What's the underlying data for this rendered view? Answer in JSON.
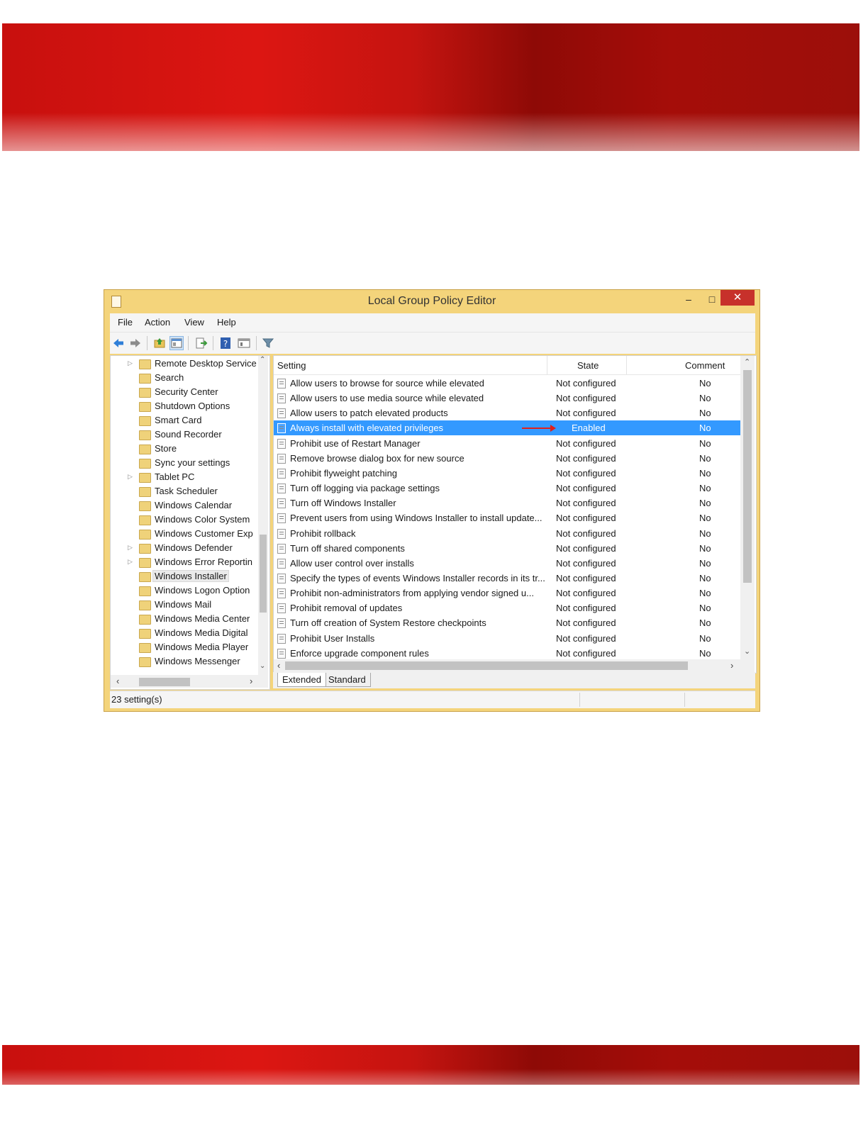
{
  "window": {
    "title": "Local Group Policy Editor",
    "minimize_glyph": "‒",
    "maximize_glyph": "□",
    "close_glyph": "✕"
  },
  "menubar": [
    "File",
    "Action",
    "View",
    "Help"
  ],
  "toolbar_icons": [
    "back-arrow-icon",
    "forward-arrow-icon",
    "up-folder-icon",
    "show-hide-tree-icon",
    "export-list-icon",
    "help-icon",
    "properties-view-icon",
    "filter-icon"
  ],
  "tree": {
    "items": [
      {
        "label": "Remote Desktop Service",
        "expandable": true
      },
      {
        "label": "Search",
        "expandable": false
      },
      {
        "label": "Security Center",
        "expandable": false
      },
      {
        "label": "Shutdown Options",
        "expandable": false
      },
      {
        "label": "Smart Card",
        "expandable": false
      },
      {
        "label": "Sound Recorder",
        "expandable": false
      },
      {
        "label": "Store",
        "expandable": false
      },
      {
        "label": "Sync your settings",
        "expandable": false
      },
      {
        "label": "Tablet PC",
        "expandable": true
      },
      {
        "label": "Task Scheduler",
        "expandable": false
      },
      {
        "label": "Windows Calendar",
        "expandable": false
      },
      {
        "label": "Windows Color System",
        "expandable": false
      },
      {
        "label": "Windows Customer Exp",
        "expandable": false
      },
      {
        "label": "Windows Defender",
        "expandable": true
      },
      {
        "label": "Windows Error Reportin",
        "expandable": true
      },
      {
        "label": "Windows Installer",
        "expandable": false,
        "selected": true
      },
      {
        "label": "Windows Logon Option",
        "expandable": false
      },
      {
        "label": "Windows Mail",
        "expandable": false
      },
      {
        "label": "Windows Media Center",
        "expandable": false
      },
      {
        "label": "Windows Media Digital",
        "expandable": false
      },
      {
        "label": "Windows Media Player",
        "expandable": false
      },
      {
        "label": "Windows Messenger",
        "expandable": false
      }
    ]
  },
  "list": {
    "headers": {
      "setting": "Setting",
      "state": "State",
      "comment": "Comment"
    },
    "rows": [
      {
        "setting": "Allow users to browse for source while elevated",
        "state": "Not configured",
        "comment": "No"
      },
      {
        "setting": "Allow users to use media source while elevated",
        "state": "Not configured",
        "comment": "No"
      },
      {
        "setting": "Allow users to patch elevated products",
        "state": "Not configured",
        "comment": "No"
      },
      {
        "setting": "Always install with elevated privileges",
        "state": "Enabled",
        "comment": "No",
        "selected": true
      },
      {
        "setting": "Prohibit use of Restart Manager",
        "state": "Not configured",
        "comment": "No"
      },
      {
        "setting": "Remove browse dialog box for new source",
        "state": "Not configured",
        "comment": "No"
      },
      {
        "setting": "Prohibit flyweight patching",
        "state": "Not configured",
        "comment": "No"
      },
      {
        "setting": "Turn off logging via package settings",
        "state": "Not configured",
        "comment": "No"
      },
      {
        "setting": "Turn off Windows Installer",
        "state": "Not configured",
        "comment": "No"
      },
      {
        "setting": "Prevent users from using Windows Installer to install update...",
        "state": "Not configured",
        "comment": "No"
      },
      {
        "setting": "Prohibit rollback",
        "state": "Not configured",
        "comment": "No"
      },
      {
        "setting": "Turn off shared components",
        "state": "Not configured",
        "comment": "No"
      },
      {
        "setting": "Allow user control over installs",
        "state": "Not configured",
        "comment": "No"
      },
      {
        "setting": "Specify the types of events Windows Installer records in its tr...",
        "state": "Not configured",
        "comment": "No"
      },
      {
        "setting": "Prohibit non-administrators from applying vendor signed u...",
        "state": "Not configured",
        "comment": "No"
      },
      {
        "setting": "Prohibit removal of updates",
        "state": "Not configured",
        "comment": "No"
      },
      {
        "setting": "Turn off creation of System Restore checkpoints",
        "state": "Not configured",
        "comment": "No"
      },
      {
        "setting": "Prohibit User Installs",
        "state": "Not configured",
        "comment": "No"
      },
      {
        "setting": "Enforce upgrade component rules",
        "state": "Not configured",
        "comment": "No"
      }
    ]
  },
  "tabs": {
    "extended": "Extended",
    "standard": "Standard"
  },
  "status": {
    "text": "23 setting(s)"
  },
  "colors": {
    "window_frame": "#f4d47b",
    "close_button": "#c7312b",
    "selection": "#3399ff",
    "annotation_arrow": "#e0201a",
    "banner": "#c8100e"
  }
}
